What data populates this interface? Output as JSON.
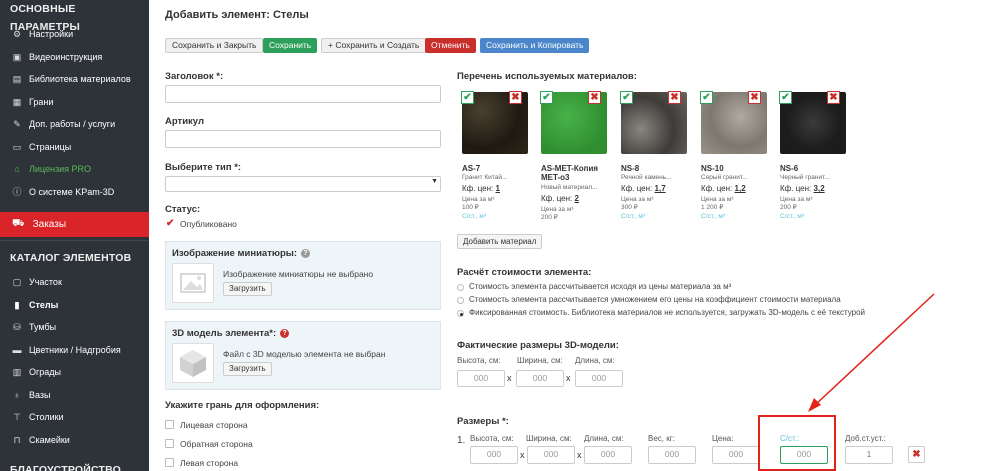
{
  "sidebar": {
    "section_main": "ОСНОВНЫЕ ПАРАМЕТРЫ",
    "main_items": [
      {
        "label": "Настройки",
        "icon": "gear-icon"
      },
      {
        "label": "Видеоинструкция",
        "icon": "video-icon"
      },
      {
        "label": "Библиотека материалов",
        "icon": "library-icon"
      },
      {
        "label": "Грани",
        "icon": "facets-icon"
      },
      {
        "label": "Доп. работы / услуги",
        "icon": "services-icon"
      },
      {
        "label": "Страницы",
        "icon": "pages-icon"
      },
      {
        "label": "Лицензия PRO",
        "icon": "license-icon"
      },
      {
        "label": "О системе KPam-3D",
        "icon": "info-icon"
      }
    ],
    "orders": "Заказы",
    "section_catalog": "КАТАЛОГ ЭЛЕМЕНТОВ",
    "catalog_items": [
      {
        "label": "Участок",
        "icon": "plot-icon"
      },
      {
        "label": "Стелы",
        "icon": "stele-icon"
      },
      {
        "label": "Тумбы",
        "icon": "pedestal-icon"
      },
      {
        "label": "Цветники / Надгробия",
        "icon": "flowerbed-icon"
      },
      {
        "label": "Ограды",
        "icon": "fence-icon"
      },
      {
        "label": "Вазы",
        "icon": "vase-icon"
      },
      {
        "label": "Столики",
        "icon": "table-icon"
      },
      {
        "label": "Скамейки",
        "icon": "bench-icon"
      }
    ],
    "section_landscape": "БЛАГОУСТРОЙСТВО"
  },
  "page": {
    "title": "Добавить элемент: Стелы"
  },
  "toolbar": {
    "save_close": "Сохранить и Закрыть",
    "save": "Сохранить",
    "save_create": "+ Сохранить и Создать",
    "cancel": "Отменить",
    "save_copy": "Сохранить и Копировать"
  },
  "form": {
    "heading_label": "Заголовок *:",
    "article_label": "Артикул",
    "type_label": "Выберите тип *:",
    "status_label": "Статус:",
    "status_value": "Опубликовано",
    "thumb_label": "Изображение миниатюры:",
    "thumb_text": "Изображение миниатюры не выбрано",
    "thumb_upload": "Загрузить",
    "model_label": "3D модель элемента*:",
    "model_text": "Файл с 3D моделью элемента не выбран",
    "model_upload": "Загрузить",
    "facet_label": "Укажите грань для оформления:",
    "facets": [
      "Лицевая сторона",
      "Обратная сторона",
      "Левая сторона"
    ]
  },
  "materials": {
    "label": "Перечень используемых материалов:",
    "items": [
      {
        "name": "AS-7",
        "sub": "Гранит Китай...",
        "kf_label": "Кф. цен:",
        "kf": "1",
        "price_label": "Цена за м³",
        "price": "100 ₽",
        "status": "",
        "color": "#2a2418"
      },
      {
        "name": "AS-MET-Копия MET-о3",
        "sub": "Новый материал...",
        "kf_label": "Кф. цен:",
        "kf": "2",
        "price_label": "Цена за м³",
        "price": "200 ₽",
        "status": "",
        "color": "#3aa03a"
      },
      {
        "name": "NS-8",
        "sub": "Речной камень...",
        "kf_label": "Кф. цен:",
        "kf": "1,7",
        "price_label": "Цена за м³",
        "price": "300 ₽",
        "status": "С/ст., м³",
        "color": "#6e6a66"
      },
      {
        "name": "NS-10",
        "sub": "Серый гранит...",
        "kf_label": "Кф. цен:",
        "kf": "1,2",
        "price_label": "Цена за м³",
        "price": "1 200 ₽",
        "status": "С/ст., м³",
        "color": "#8f8a82"
      },
      {
        "name": "NS-6",
        "sub": "Черный гранит...",
        "kf_label": "Кф. цен:",
        "kf": "3,2",
        "price_label": "Цена за м³",
        "price": "200 ₽",
        "status": "С/ст., м³",
        "color": "#262626"
      }
    ],
    "first_status": "С/ст., м³",
    "add_button": "Добавить материал"
  },
  "cost": {
    "label": "Расчёт стоимости элемента:",
    "options": [
      "Стоимость элемента рассчитывается исходя из цены материала за м³",
      "Стоимость элемента рассчитывается умножением его цены на коэффициент стоимости материала",
      "Фиксированная стоимость. Библиотека материалов не используется, загружать 3D-модель с её текстурой"
    ],
    "selected_index": 2
  },
  "dims3d": {
    "label": "Фактические размеры 3D-модели:",
    "height_label": "Высота, см:",
    "width_label": "Ширина, см:",
    "length_label": "Длина, см:",
    "placeholder": "000"
  },
  "sizes": {
    "label": "Размеры *:",
    "row_num": "1.",
    "height_label": "Высота, см:",
    "width_label": "Ширина, см:",
    "length_label": "Длина, см:",
    "weight_label": "Вес, кг:",
    "price_label": "Цена:",
    "cost_label": "С/ст.:",
    "add_cost_label": "Доб.ст.уст.:",
    "placeholder": "000",
    "add_cost_value": "1"
  },
  "colors": {
    "sidebar_bg": "#2d3338",
    "orders_bg": "#d9252a",
    "save_green": "#2ca05a",
    "cancel_red": "#c9302c",
    "copy_blue": "#4a86c9",
    "annotation_red": "#e2231a"
  }
}
